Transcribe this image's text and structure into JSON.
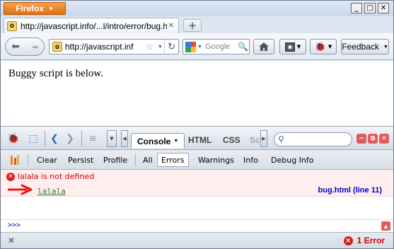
{
  "browser": {
    "app_button": "Firefox",
    "tab_title": "http://javascript.info/...l/intro/error/bug.html",
    "url": "http://javascript.inf",
    "search_placeholder": "Google",
    "feedback": "Feedback"
  },
  "page": {
    "body_text": "Buggy script is below."
  },
  "firebug": {
    "tabs": {
      "console": "Console",
      "html": "HTML",
      "css": "CSS",
      "script": "Sc"
    },
    "subbar": {
      "clear": "Clear",
      "persist": "Persist",
      "profile": "Profile",
      "all": "All",
      "errors": "Errors",
      "warnings": "Warnings",
      "info": "Info",
      "debug_info": "Debug Info"
    },
    "error": {
      "message": "lalala is not defined",
      "source_line": "lalala",
      "location": "bug.html (line 11)"
    },
    "prompt": ">>>",
    "status_errors": "1 Error"
  },
  "colors": {
    "error_red": "#d00000",
    "error_bg": "#ffeeee",
    "link_blue": "#0000cc",
    "source_green": "#2c7a2c",
    "firefox_orange": "#e0700f"
  }
}
